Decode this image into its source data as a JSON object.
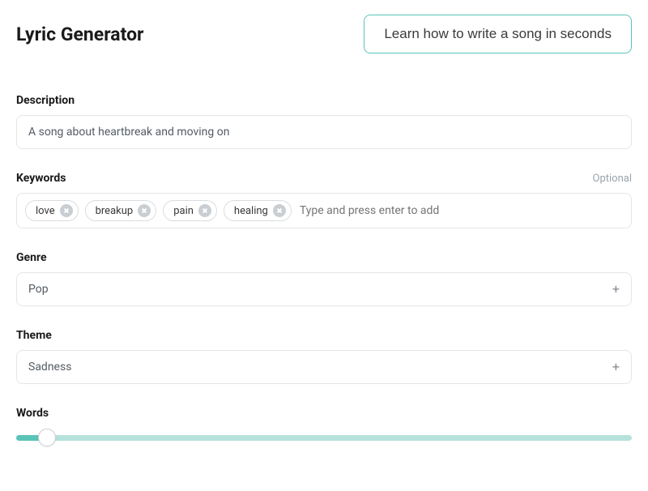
{
  "header": {
    "title": "Lyric Generator",
    "learn_button": "Learn how to write a song in seconds"
  },
  "description": {
    "label": "Description",
    "value": "A song about heartbreak and moving on"
  },
  "keywords": {
    "label": "Keywords",
    "optional": "Optional",
    "tags": [
      "love",
      "breakup",
      "pain",
      "healing"
    ],
    "placeholder": "Type and press enter to add"
  },
  "genre": {
    "label": "Genre",
    "value": "Pop"
  },
  "theme": {
    "label": "Theme",
    "value": "Sadness"
  },
  "words": {
    "label": "Words",
    "percent": 5
  }
}
